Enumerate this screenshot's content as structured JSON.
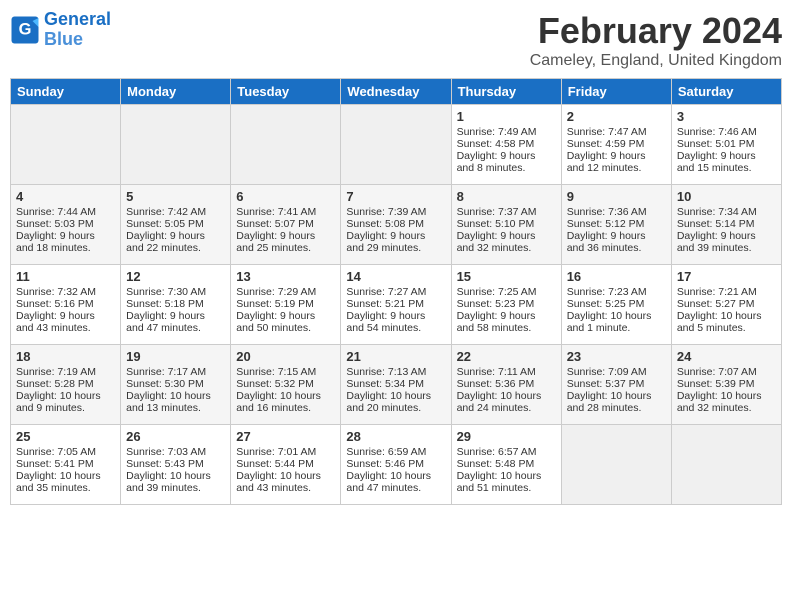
{
  "header": {
    "logo_line1": "General",
    "logo_line2": "Blue",
    "title": "February 2024",
    "subtitle": "Cameley, England, United Kingdom"
  },
  "weekdays": [
    "Sunday",
    "Monday",
    "Tuesday",
    "Wednesday",
    "Thursday",
    "Friday",
    "Saturday"
  ],
  "weeks": [
    [
      {
        "day": "",
        "empty": true
      },
      {
        "day": "",
        "empty": true
      },
      {
        "day": "",
        "empty": true
      },
      {
        "day": "",
        "empty": true
      },
      {
        "day": "1",
        "sunrise": "Sunrise: 7:49 AM",
        "sunset": "Sunset: 4:58 PM",
        "daylight": "Daylight: 9 hours and 8 minutes."
      },
      {
        "day": "2",
        "sunrise": "Sunrise: 7:47 AM",
        "sunset": "Sunset: 4:59 PM",
        "daylight": "Daylight: 9 hours and 12 minutes."
      },
      {
        "day": "3",
        "sunrise": "Sunrise: 7:46 AM",
        "sunset": "Sunset: 5:01 PM",
        "daylight": "Daylight: 9 hours and 15 minutes."
      }
    ],
    [
      {
        "day": "4",
        "sunrise": "Sunrise: 7:44 AM",
        "sunset": "Sunset: 5:03 PM",
        "daylight": "Daylight: 9 hours and 18 minutes."
      },
      {
        "day": "5",
        "sunrise": "Sunrise: 7:42 AM",
        "sunset": "Sunset: 5:05 PM",
        "daylight": "Daylight: 9 hours and 22 minutes."
      },
      {
        "day": "6",
        "sunrise": "Sunrise: 7:41 AM",
        "sunset": "Sunset: 5:07 PM",
        "daylight": "Daylight: 9 hours and 25 minutes."
      },
      {
        "day": "7",
        "sunrise": "Sunrise: 7:39 AM",
        "sunset": "Sunset: 5:08 PM",
        "daylight": "Daylight: 9 hours and 29 minutes."
      },
      {
        "day": "8",
        "sunrise": "Sunrise: 7:37 AM",
        "sunset": "Sunset: 5:10 PM",
        "daylight": "Daylight: 9 hours and 32 minutes."
      },
      {
        "day": "9",
        "sunrise": "Sunrise: 7:36 AM",
        "sunset": "Sunset: 5:12 PM",
        "daylight": "Daylight: 9 hours and 36 minutes."
      },
      {
        "day": "10",
        "sunrise": "Sunrise: 7:34 AM",
        "sunset": "Sunset: 5:14 PM",
        "daylight": "Daylight: 9 hours and 39 minutes."
      }
    ],
    [
      {
        "day": "11",
        "sunrise": "Sunrise: 7:32 AM",
        "sunset": "Sunset: 5:16 PM",
        "daylight": "Daylight: 9 hours and 43 minutes."
      },
      {
        "day": "12",
        "sunrise": "Sunrise: 7:30 AM",
        "sunset": "Sunset: 5:18 PM",
        "daylight": "Daylight: 9 hours and 47 minutes."
      },
      {
        "day": "13",
        "sunrise": "Sunrise: 7:29 AM",
        "sunset": "Sunset: 5:19 PM",
        "daylight": "Daylight: 9 hours and 50 minutes."
      },
      {
        "day": "14",
        "sunrise": "Sunrise: 7:27 AM",
        "sunset": "Sunset: 5:21 PM",
        "daylight": "Daylight: 9 hours and 54 minutes."
      },
      {
        "day": "15",
        "sunrise": "Sunrise: 7:25 AM",
        "sunset": "Sunset: 5:23 PM",
        "daylight": "Daylight: 9 hours and 58 minutes."
      },
      {
        "day": "16",
        "sunrise": "Sunrise: 7:23 AM",
        "sunset": "Sunset: 5:25 PM",
        "daylight": "Daylight: 10 hours and 1 minute."
      },
      {
        "day": "17",
        "sunrise": "Sunrise: 7:21 AM",
        "sunset": "Sunset: 5:27 PM",
        "daylight": "Daylight: 10 hours and 5 minutes."
      }
    ],
    [
      {
        "day": "18",
        "sunrise": "Sunrise: 7:19 AM",
        "sunset": "Sunset: 5:28 PM",
        "daylight": "Daylight: 10 hours and 9 minutes."
      },
      {
        "day": "19",
        "sunrise": "Sunrise: 7:17 AM",
        "sunset": "Sunset: 5:30 PM",
        "daylight": "Daylight: 10 hours and 13 minutes."
      },
      {
        "day": "20",
        "sunrise": "Sunrise: 7:15 AM",
        "sunset": "Sunset: 5:32 PM",
        "daylight": "Daylight: 10 hours and 16 minutes."
      },
      {
        "day": "21",
        "sunrise": "Sunrise: 7:13 AM",
        "sunset": "Sunset: 5:34 PM",
        "daylight": "Daylight: 10 hours and 20 minutes."
      },
      {
        "day": "22",
        "sunrise": "Sunrise: 7:11 AM",
        "sunset": "Sunset: 5:36 PM",
        "daylight": "Daylight: 10 hours and 24 minutes."
      },
      {
        "day": "23",
        "sunrise": "Sunrise: 7:09 AM",
        "sunset": "Sunset: 5:37 PM",
        "daylight": "Daylight: 10 hours and 28 minutes."
      },
      {
        "day": "24",
        "sunrise": "Sunrise: 7:07 AM",
        "sunset": "Sunset: 5:39 PM",
        "daylight": "Daylight: 10 hours and 32 minutes."
      }
    ],
    [
      {
        "day": "25",
        "sunrise": "Sunrise: 7:05 AM",
        "sunset": "Sunset: 5:41 PM",
        "daylight": "Daylight: 10 hours and 35 minutes."
      },
      {
        "day": "26",
        "sunrise": "Sunrise: 7:03 AM",
        "sunset": "Sunset: 5:43 PM",
        "daylight": "Daylight: 10 hours and 39 minutes."
      },
      {
        "day": "27",
        "sunrise": "Sunrise: 7:01 AM",
        "sunset": "Sunset: 5:44 PM",
        "daylight": "Daylight: 10 hours and 43 minutes."
      },
      {
        "day": "28",
        "sunrise": "Sunrise: 6:59 AM",
        "sunset": "Sunset: 5:46 PM",
        "daylight": "Daylight: 10 hours and 47 minutes."
      },
      {
        "day": "29",
        "sunrise": "Sunrise: 6:57 AM",
        "sunset": "Sunset: 5:48 PM",
        "daylight": "Daylight: 10 hours and 51 minutes."
      },
      {
        "day": "",
        "empty": true
      },
      {
        "day": "",
        "empty": true
      }
    ]
  ]
}
